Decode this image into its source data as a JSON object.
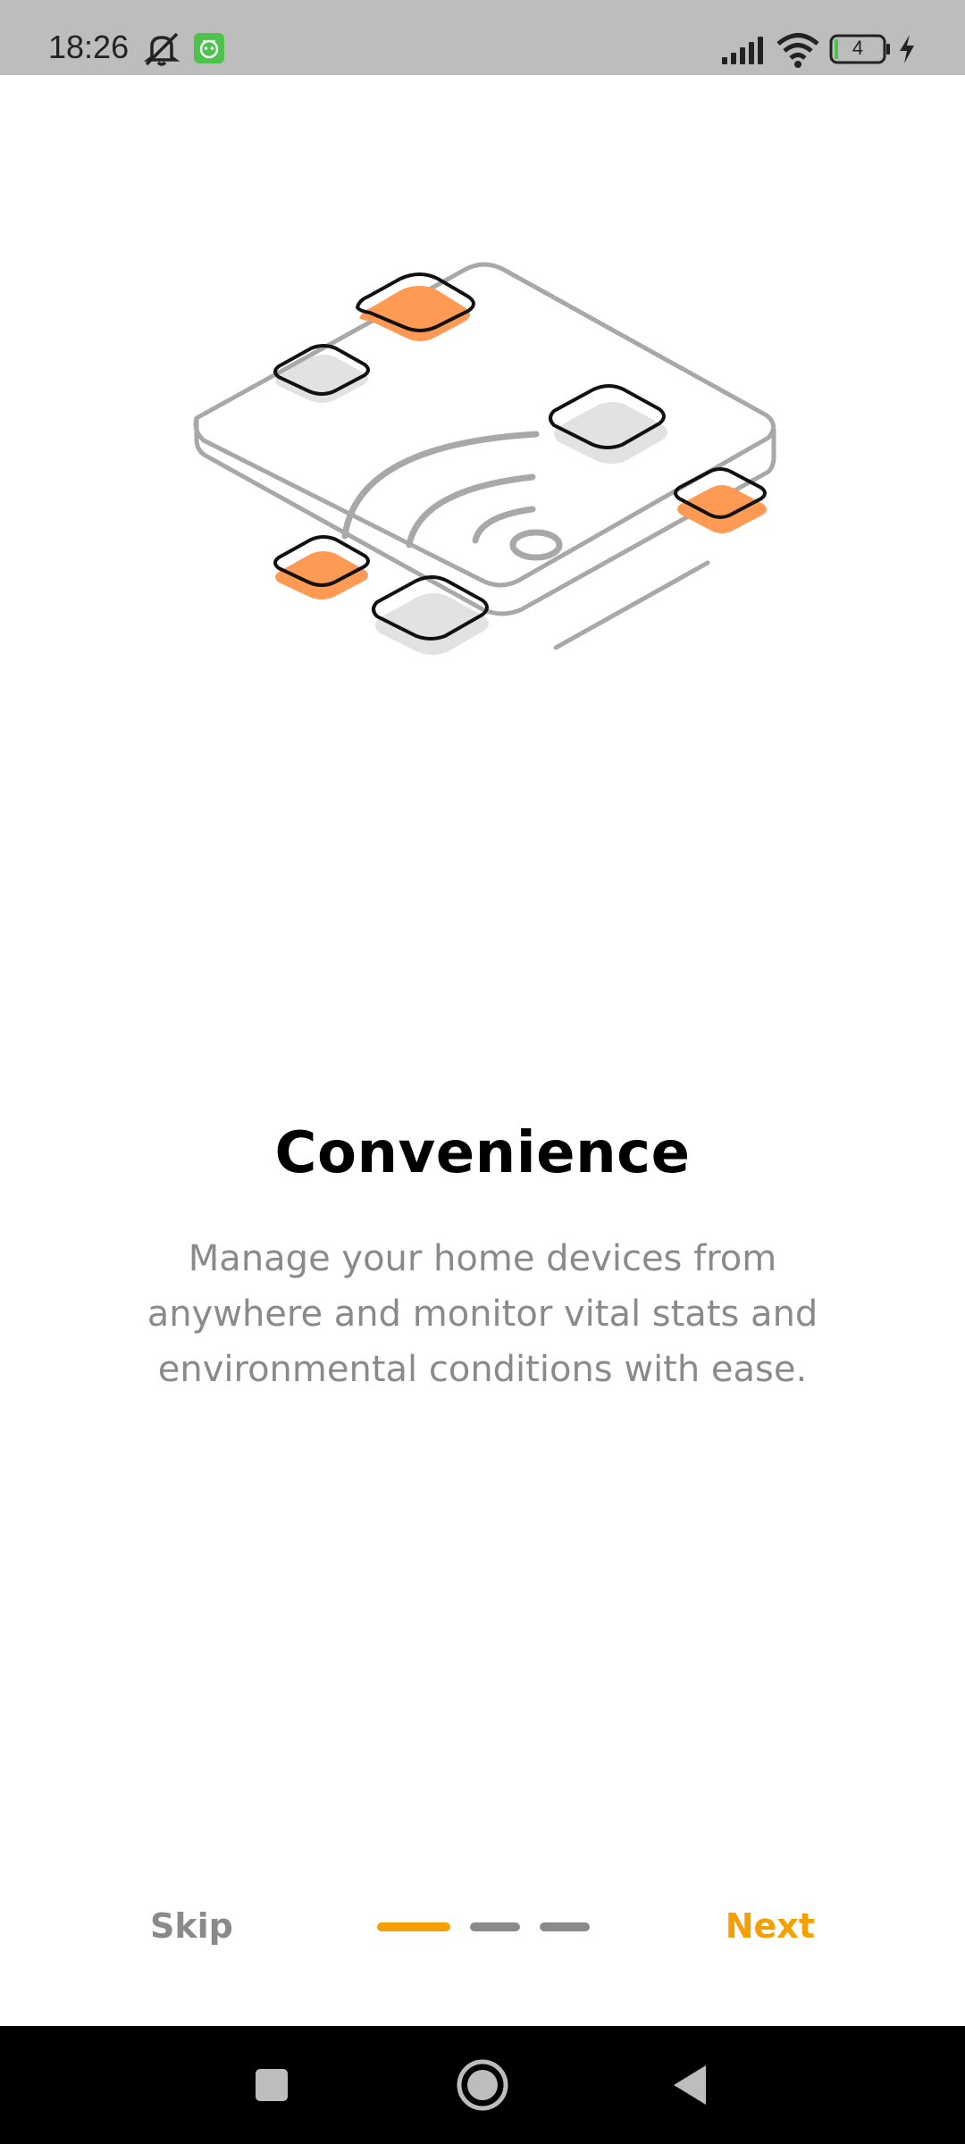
{
  "status_bar": {
    "time": "18:26",
    "battery_level": "4",
    "icons": [
      "mute-bell-icon",
      "app-notification-icon",
      "signal-icon",
      "wifi-icon",
      "battery-icon",
      "charging-icon"
    ]
  },
  "onboarding": {
    "title": "Convenience",
    "description_lines": [
      "Manage your home devices from",
      "anywhere and monitor vital stats and",
      "environmental conditions with ease."
    ],
    "illustration": "smart-home-hub-illustration",
    "page_indicator": {
      "total": 3,
      "current": 1
    }
  },
  "controls": {
    "skip_label": "Skip",
    "next_label": "Next"
  },
  "nav_bar": {
    "icons": [
      "recents-square-icon",
      "home-circle-icon",
      "back-triangle-icon"
    ]
  },
  "colors": {
    "accent": "#f5a000",
    "illustration_orange": "#ff9a55",
    "muted_text": "#8a8a8a",
    "status_bar_bg": "#bdbdbd",
    "nav_bar_bg": "#000000"
  }
}
